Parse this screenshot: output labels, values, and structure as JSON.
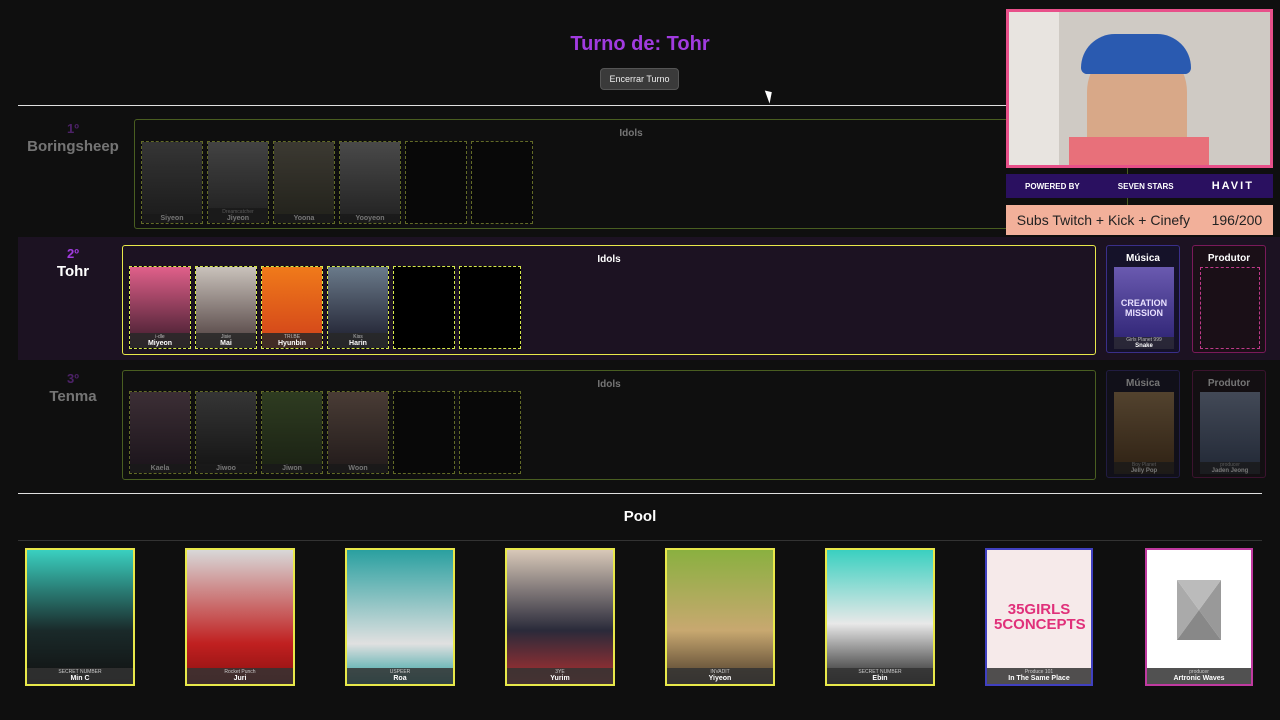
{
  "header": {
    "turn_title": "Turno de: Tohr",
    "end_turn_label": "Encerrar Turno"
  },
  "players": [
    {
      "position": "1º",
      "name": "Boringsheep",
      "box_title": "Idols",
      "idols": [
        {
          "group": "",
          "name": "Siyeon"
        },
        {
          "group": "Dreamcatcher",
          "name": "Jiyeon"
        },
        {
          "group": "",
          "name": "Yoona"
        },
        {
          "group": "",
          "name": "Yooyeon"
        }
      ]
    },
    {
      "position": "2º",
      "name": "Tohr",
      "box_title": "Idols",
      "music_title": "Música",
      "producer_title": "Produtor",
      "idols": [
        {
          "group": "i-dle",
          "name": "Miyeon"
        },
        {
          "group": "Jisie",
          "name": "Mai"
        },
        {
          "group": "TRI.BE",
          "name": "Hyunbin"
        },
        {
          "group": "Kiss",
          "name": "Harin"
        }
      ],
      "music": {
        "group": "Girls Planet 999",
        "name": "Snake",
        "art_text": "CREATION MISSION"
      }
    },
    {
      "position": "3º",
      "name": "Tenma",
      "box_title": "Idols",
      "music_title": "Música",
      "producer_title": "Produtor",
      "idols": [
        {
          "group": "",
          "name": "Kaela"
        },
        {
          "group": "",
          "name": "Jiwoo"
        },
        {
          "group": "",
          "name": "Jiwon"
        },
        {
          "group": "",
          "name": "Woon"
        }
      ],
      "music": {
        "group": "Boy Planet",
        "name": "Jelly Pop"
      },
      "producer": {
        "group": "producer",
        "name": "Jaden Jeong"
      }
    }
  ],
  "pool": {
    "title": "Pool",
    "cards": [
      {
        "group": "SECRET NUMBER",
        "name": "Min C"
      },
      {
        "group": "Rocket Punch",
        "name": "Juri"
      },
      {
        "group": "USPEER",
        "name": "Roa"
      },
      {
        "group": "3YE",
        "name": "Yurim"
      },
      {
        "group": "INVADIT",
        "name": "Yiyeon"
      },
      {
        "group": "SECRET NUMBER",
        "name": "Ebin"
      },
      {
        "group": "Produce 101",
        "name": "In The Same Place",
        "art_text": "35GIRLS 5CONCEPTS"
      },
      {
        "group": "producer",
        "name": "Artronic Waves"
      }
    ]
  },
  "overlay": {
    "sponsor_left": "POWERED BY",
    "sponsor_mid": "SEVEN STARS",
    "sponsor_right": "HAVIT",
    "subs_label": "Subs Twitch + Kick + Cinefy",
    "subs_count": "196/200"
  },
  "colors": {
    "accent": "#a13be0",
    "slot_border": "#d5e84a",
    "active_box": "#e8e84a"
  }
}
